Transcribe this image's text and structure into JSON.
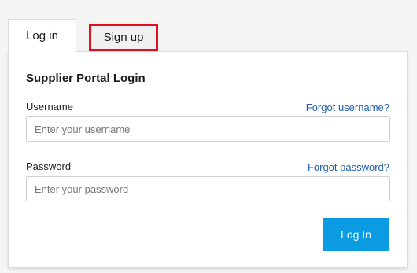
{
  "tabs": {
    "login_label": "Log in",
    "signup_label": "Sign up"
  },
  "form": {
    "title": "Supplier Portal Login",
    "username": {
      "label": "Username",
      "placeholder": "Enter your username",
      "value": "",
      "forgot_link": "Forgot username?"
    },
    "password": {
      "label": "Password",
      "placeholder": "Enter your password",
      "value": "",
      "forgot_link": "Forgot password?"
    },
    "submit_label": "Log In"
  },
  "colors": {
    "accent": "#0a9be3",
    "link": "#1f5fae",
    "highlight": "#e0101e"
  }
}
